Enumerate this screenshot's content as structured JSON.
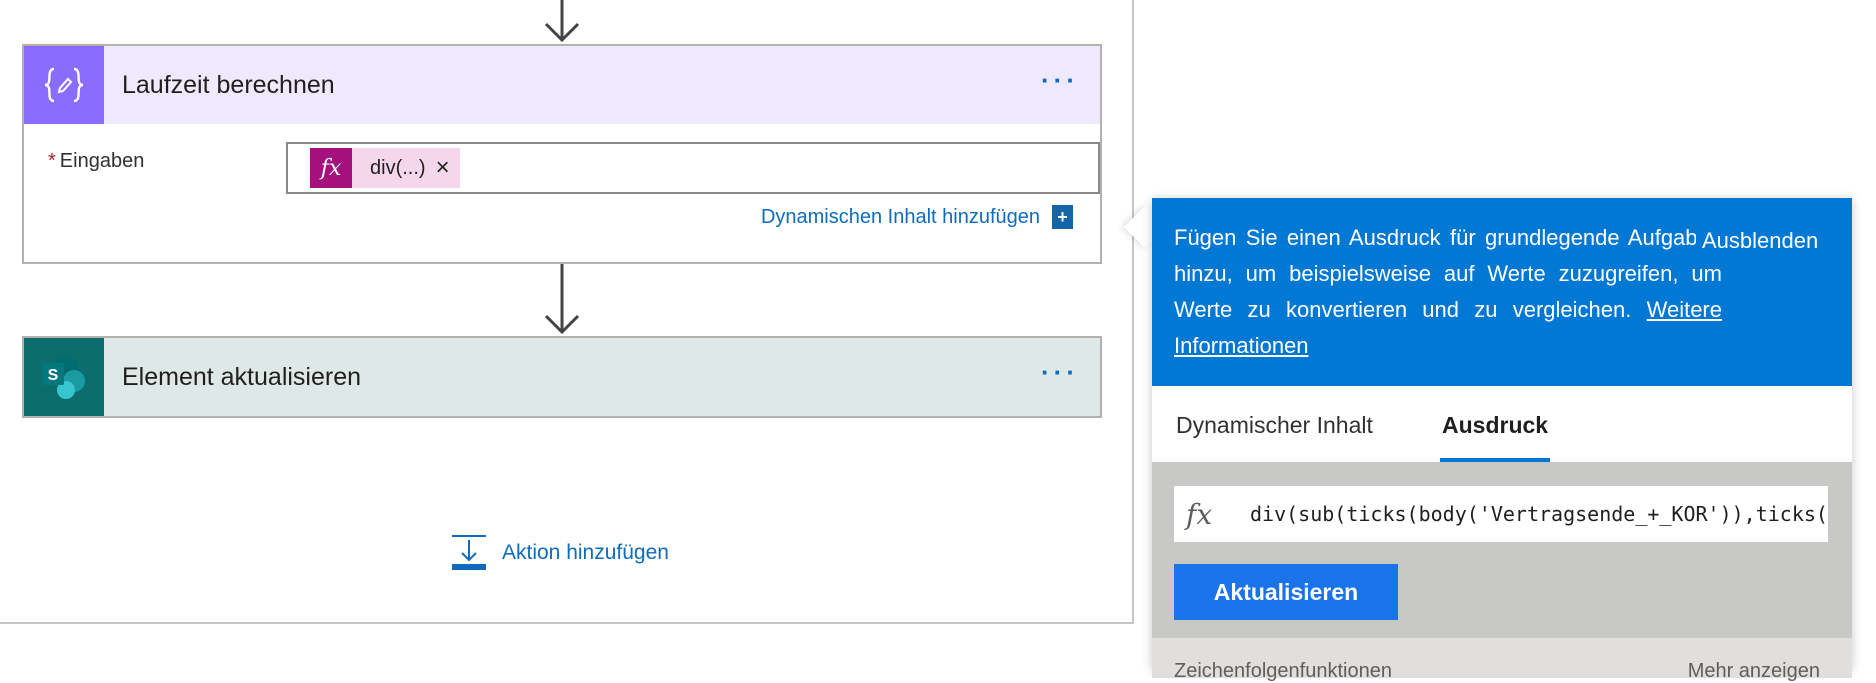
{
  "flow": {
    "compose_card": {
      "title": "Laufzeit berechnen",
      "icon": "compose-icon",
      "more": "···",
      "field_required_mark": "*",
      "field_label": "Eingaben",
      "token_icon": "fx",
      "token_text": "div(...)",
      "token_close": "×",
      "dynamic_link": "Dynamischen Inhalt hinzufügen",
      "dynamic_plus": "+",
      "accent_color": "#8a6cff"
    },
    "sharepoint_card": {
      "title": "Element aktualisieren",
      "icon": "sharepoint-icon",
      "more": "···",
      "accent_color": "#0b6e6d"
    },
    "add_action": {
      "label": "Aktion hinzufügen",
      "icon": "add-action-icon"
    }
  },
  "expression_panel": {
    "info_text": "Fügen Sie einen Ausdruck für grundlegende Aufgaben hinzu, um beispielsweise auf Werte zuzugreifen, um Werte zu konvertieren und zu vergleichen.",
    "learn_more": "Weitere Informationen",
    "hide_label": "Ausblenden",
    "tabs": [
      {
        "label": "Dynamischer Inhalt",
        "active": false
      },
      {
        "label": "Ausdruck",
        "active": true
      }
    ],
    "expression_icon": "fx",
    "expression_value": "div(sub(ticks(body('Vertragsende_+_KOR')),ticks(",
    "update_button": "Aktualisieren",
    "footer_left": "Zeichenfolgenfunktionen",
    "footer_right": "Mehr anzeigen",
    "accent_color": "#0078d4"
  }
}
